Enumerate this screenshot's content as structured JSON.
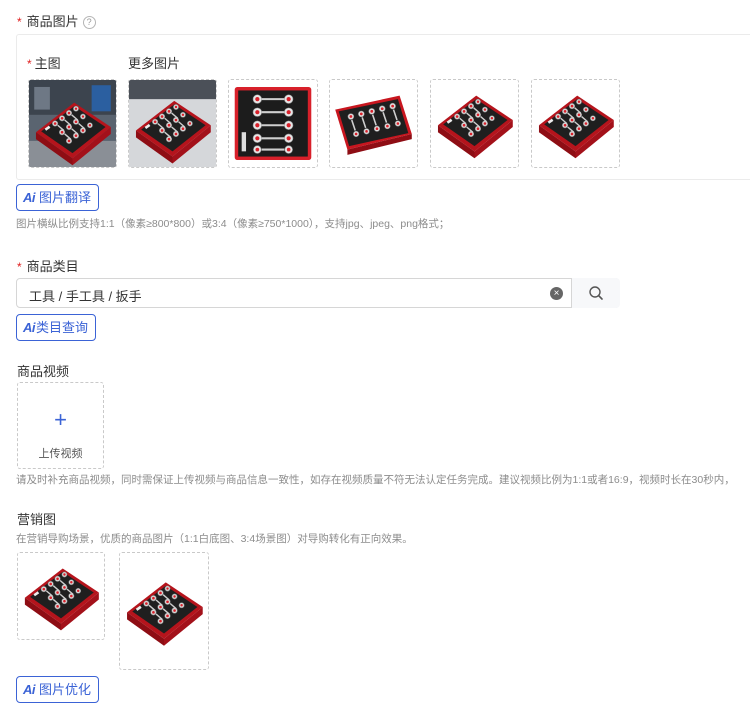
{
  "product_images": {
    "label": "商品图片",
    "required_mark": "*",
    "help_icon": "?",
    "main_label": "主图",
    "more_label": "更多图片",
    "thumbnails": [
      {
        "scene": "workshop"
      },
      {
        "scene": "studio"
      },
      {
        "scene": "flat-top"
      },
      {
        "scene": "angled"
      },
      {
        "scene": "angled"
      },
      {
        "scene": "angled"
      }
    ],
    "ai_button": "图片翻译",
    "hint": "图片横纵比例支持1:1（像素≥800*800）或3:4（像素≥750*1000），支持jpg、jpeg、png格式；"
  },
  "category": {
    "label": "商品类目",
    "required_mark": "*",
    "value": "工具 / 手工具 / 扳手",
    "clear_icon": "×",
    "ai_button": "类目查询"
  },
  "video": {
    "label": "商品视频",
    "upload_plus": "+",
    "upload_text": "上传视频",
    "hint": "请及时补充商品视频，同时需保证上传视频与商品信息一致性，如存在视频质量不符无法认定任务完成。建议视频比例为1:1或者16:9，视频时长在30秒内，"
  },
  "marketing": {
    "label": "营销图",
    "hint": "在营销导购场景，优质的商品图片（1:1白底图、3:4场景图）对导购转化有正向效果。",
    "thumbnails": [
      {
        "scene": "angled"
      },
      {
        "scene": "angled"
      }
    ],
    "ai_button": "图片优化"
  },
  "ai_mark": "Ai",
  "colors": {
    "accent": "#3b63d6",
    "required": "#e02020",
    "tray_red": "#d8202a",
    "foam_black": "#1f1f1f"
  }
}
